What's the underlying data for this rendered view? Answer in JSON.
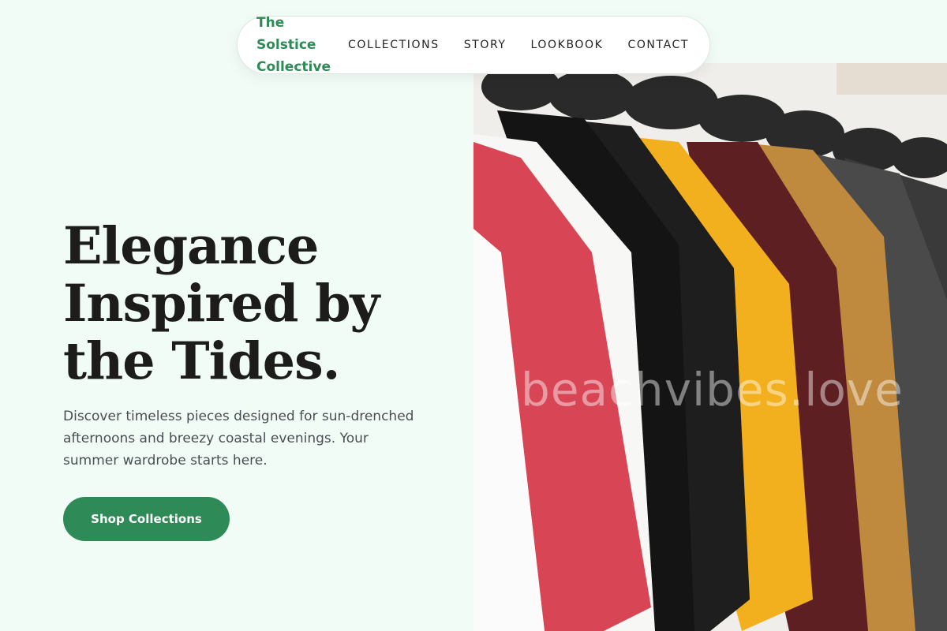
{
  "navbar": {
    "brand": "The Solstice Collective",
    "links": [
      "COLLECTIONS",
      "STORY",
      "LOOKBOOK",
      "CONTACT"
    ]
  },
  "hero": {
    "title": "Elegance Inspired by the Tides.",
    "description": "Discover timeless pieces designed for sun-drenched afternoons and breezy coastal evenings. Your summer wardrobe starts here.",
    "cta_label": "Shop Collections",
    "image_watermark": "beachvibes.love"
  },
  "colors": {
    "background": "#f1fcf7",
    "accent": "#2e8a57",
    "heading": "#1c1c1a",
    "body_text": "#4a4e52"
  }
}
